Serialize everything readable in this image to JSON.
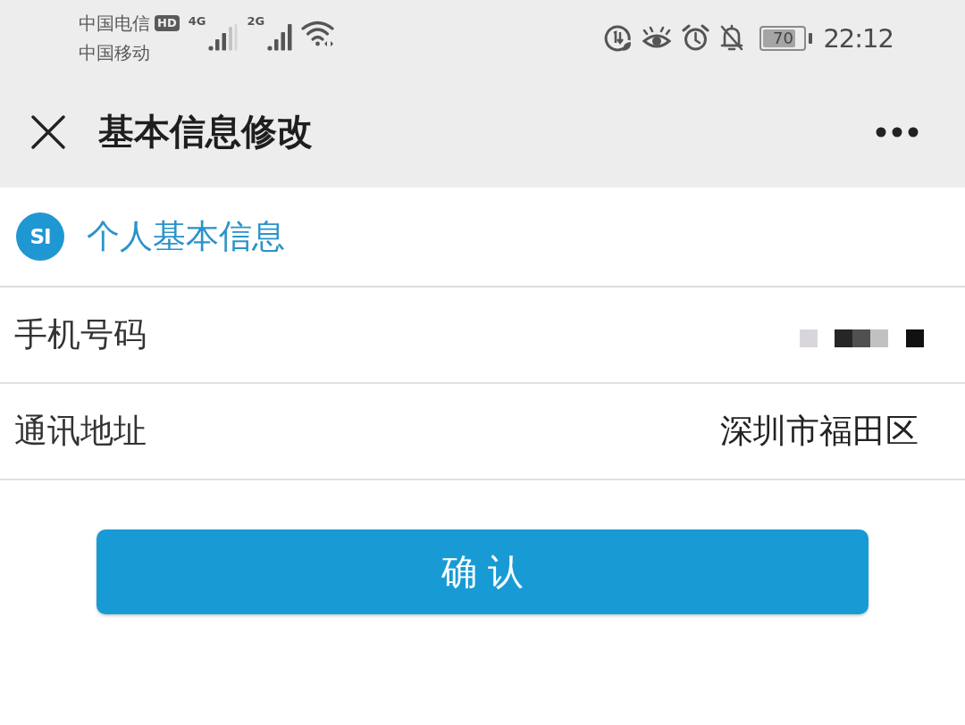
{
  "status_bar": {
    "carriers": [
      {
        "name": "中国电信",
        "badge": "HD"
      },
      {
        "name": "中国移动"
      }
    ],
    "signals": [
      {
        "label": "4G",
        "kind": "partial"
      },
      {
        "label": "2G",
        "kind": "full"
      }
    ],
    "battery": {
      "text": "70"
    },
    "time": "22:12"
  },
  "title_bar": {
    "title": "基本信息修改"
  },
  "section": {
    "badge": "SI",
    "title": "个人基本信息"
  },
  "fields": [
    {
      "label": "手机号码",
      "kind": "redacted"
    },
    {
      "label": "通讯地址",
      "kind": "text",
      "value": "深圳市福田区"
    }
  ],
  "confirm_button": {
    "label": "确 认"
  }
}
